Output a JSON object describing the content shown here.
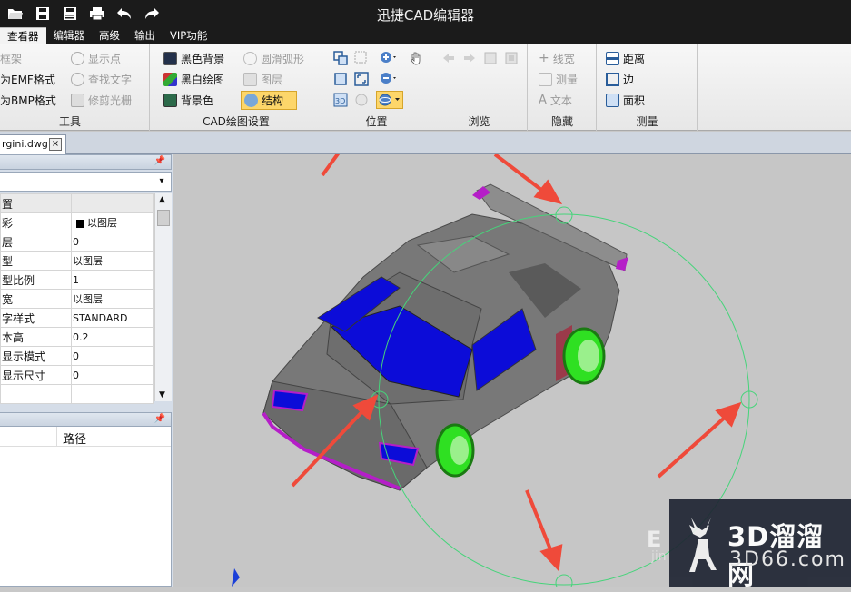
{
  "app": {
    "title": "迅捷CAD编辑器"
  },
  "menu": {
    "tabs": [
      "查看器",
      "编辑器",
      "高级",
      "输出",
      "VIP功能"
    ]
  },
  "ribbon": {
    "tools": {
      "caption": "工具",
      "items": [
        "框架",
        "为EMF格式",
        "为BMP格式",
        "显示点",
        "查找文字",
        "修剪光栅"
      ]
    },
    "cad": {
      "caption": "CAD绘图设置",
      "items": [
        "黑色背景",
        "黑白绘图",
        "背景色",
        "圆滑弧形",
        "图层",
        "结构"
      ]
    },
    "position": {
      "caption": "位置"
    },
    "browse": {
      "caption": "浏览"
    },
    "hide": {
      "caption": "隐藏",
      "items": [
        "线宽",
        "测量",
        "文本"
      ]
    },
    "measure": {
      "caption": "测量",
      "items": [
        "距离",
        "边",
        "面积"
      ]
    }
  },
  "doc": {
    "tab": "rgini.dwg",
    "close": "×"
  },
  "props": {
    "rows": [
      {
        "k": "置",
        "v": ""
      },
      {
        "k": "彩",
        "v": "以图层"
      },
      {
        "k": "层",
        "v": "0"
      },
      {
        "k": "型",
        "v": "以图层"
      },
      {
        "k": "型比例",
        "v": "1"
      },
      {
        "k": "宽",
        "v": "以图层"
      },
      {
        "k": "字样式",
        "v": "STANDARD"
      },
      {
        "k": "本高",
        "v": "0.2"
      },
      {
        "k": "显示模式",
        "v": "0"
      },
      {
        "k": "显示尺寸",
        "v": "0"
      },
      {
        "k": "",
        "v": ""
      }
    ]
  },
  "pathpanel": {
    "column": "路径"
  },
  "watermark": {
    "big": "3D溜溜网",
    "small": "3D66.com",
    "left": "E",
    "left2": "jin"
  },
  "colors": {
    "titlebar": "#1b1b1b",
    "arrow": "#ef4a3a",
    "orbit": "#46d47a",
    "glass": "#0c0cd8",
    "wheel": "#2fe022",
    "accent": "#b51ec8"
  }
}
